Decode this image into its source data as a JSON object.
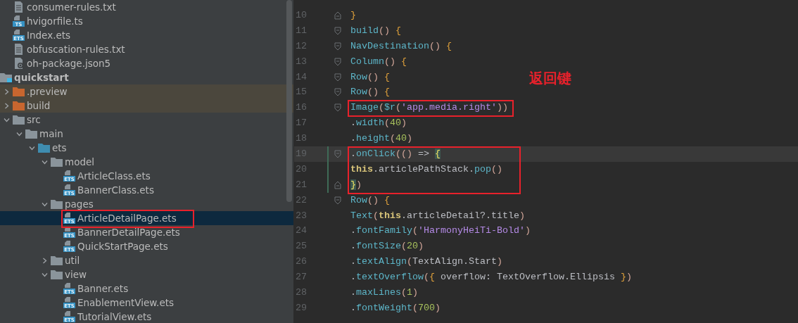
{
  "project_tree": {
    "cut_off_files": [
      {
        "name": "consumer-rules.txt",
        "kind": "text",
        "selected": false,
        "excluded": false,
        "boxed": false
      },
      {
        "name": "hvigorfile.ts",
        "kind": "code",
        "badge": "TS",
        "selected": false,
        "excluded": false,
        "boxed": false
      },
      {
        "name": "Index.ets",
        "kind": "code",
        "badge": "ETS",
        "selected": false,
        "excluded": false,
        "boxed": false
      },
      {
        "name": "obfuscation-rules.txt",
        "kind": "text",
        "selected": false,
        "excluded": false,
        "boxed": false
      },
      {
        "name": "oh-package.json5",
        "kind": "json",
        "selected": false,
        "excluded": false,
        "boxed": false
      }
    ],
    "modules": [
      {
        "name": "quickstart",
        "kind": "module",
        "selected": false,
        "excluded": false,
        "boxed": false,
        "children": [
          {
            "name": ".preview",
            "kind": "excluded_folder",
            "expanded": false,
            "selected": false,
            "excluded": true,
            "boxed": false
          },
          {
            "name": "build",
            "kind": "excluded_folder",
            "expanded": false,
            "selected": false,
            "excluded": true,
            "boxed": false
          },
          {
            "name": "src",
            "kind": "folder",
            "expanded": true,
            "selected": false,
            "excluded": false,
            "boxed": false,
            "children": [
              {
                "name": "main",
                "kind": "folder",
                "expanded": true,
                "selected": false,
                "excluded": false,
                "boxed": false,
                "children": [
                  {
                    "name": "ets",
                    "kind": "source_folder",
                    "expanded": true,
                    "selected": false,
                    "excluded": false,
                    "boxed": false,
                    "children": [
                      {
                        "name": "model",
                        "kind": "folder",
                        "expanded": true,
                        "selected": false,
                        "excluded": false,
                        "boxed": false,
                        "children": [
                          {
                            "name": "ArticleClass.ets",
                            "kind": "code",
                            "badge": "ETS",
                            "selected": false,
                            "excluded": false,
                            "boxed": false
                          },
                          {
                            "name": "BannerClass.ets",
                            "kind": "code",
                            "badge": "ETS",
                            "selected": false,
                            "excluded": false,
                            "boxed": false
                          }
                        ]
                      },
                      {
                        "name": "pages",
                        "kind": "folder",
                        "expanded": true,
                        "selected": false,
                        "excluded": false,
                        "boxed": false,
                        "children": [
                          {
                            "name": "ArticleDetailPage.ets",
                            "kind": "code",
                            "badge": "ETS",
                            "selected": true,
                            "excluded": false,
                            "boxed": true
                          },
                          {
                            "name": "BannerDetailPage.ets",
                            "kind": "code",
                            "badge": "ETS",
                            "selected": false,
                            "excluded": false,
                            "boxed": false
                          },
                          {
                            "name": "QuickStartPage.ets",
                            "kind": "code",
                            "badge": "ETS",
                            "selected": false,
                            "excluded": false,
                            "boxed": false
                          }
                        ]
                      },
                      {
                        "name": "util",
                        "kind": "folder",
                        "expanded": false,
                        "selected": false,
                        "excluded": false,
                        "boxed": false
                      },
                      {
                        "name": "view",
                        "kind": "folder",
                        "expanded": true,
                        "selected": false,
                        "excluded": false,
                        "boxed": false,
                        "children": [
                          {
                            "name": "Banner.ets",
                            "kind": "code",
                            "badge": "ETS",
                            "selected": false,
                            "excluded": false,
                            "boxed": false
                          },
                          {
                            "name": "EnablementView.ets",
                            "kind": "code",
                            "badge": "ETS",
                            "selected": false,
                            "excluded": false,
                            "boxed": false
                          },
                          {
                            "name": "TutorialView.ets",
                            "kind": "code",
                            "badge": "ETS",
                            "selected": false,
                            "excluded": false,
                            "boxed": false
                          }
                        ]
                      }
                    ]
                  }
                ]
              }
            ]
          }
        ]
      }
    ]
  },
  "editor": {
    "label": "返回键",
    "lines": [
      {
        "number": "10",
        "fold_start": false,
        "fold_end": true,
        "changed": false,
        "current": false,
        "boxed": false,
        "tokens": [
          {
            "kind": "brace",
            "text": "}"
          }
        ]
      },
      {
        "number": "11",
        "fold_start": true,
        "fold_end": false,
        "changed": false,
        "current": false,
        "boxed": false,
        "tokens": [
          {
            "kind": "function",
            "text": "build"
          },
          {
            "kind": "paren",
            "text": "()"
          },
          {
            "kind": "brace",
            "text": " {"
          }
        ]
      },
      {
        "number": "12",
        "fold_start": true,
        "fold_end": false,
        "changed": false,
        "current": false,
        "boxed": false,
        "tokens": [
          {
            "kind": "function",
            "text": "  NavDestination"
          },
          {
            "kind": "paren",
            "text": "()"
          },
          {
            "kind": "brace",
            "text": " {"
          }
        ]
      },
      {
        "number": "13",
        "fold_start": true,
        "fold_end": false,
        "changed": false,
        "current": false,
        "boxed": false,
        "tokens": [
          {
            "kind": "function",
            "text": "    Column"
          },
          {
            "kind": "paren",
            "text": "()"
          },
          {
            "kind": "brace",
            "text": " {"
          }
        ]
      },
      {
        "number": "14",
        "fold_start": true,
        "fold_end": false,
        "changed": false,
        "current": false,
        "boxed": false,
        "tokens": [
          {
            "kind": "function",
            "text": "      Row"
          },
          {
            "kind": "paren",
            "text": "()"
          },
          {
            "kind": "brace",
            "text": " {"
          }
        ]
      },
      {
        "number": "15",
        "fold_start": true,
        "fold_end": false,
        "changed": false,
        "current": false,
        "boxed": false,
        "tokens": [
          {
            "kind": "function",
            "text": "        Row"
          },
          {
            "kind": "paren",
            "text": "()"
          },
          {
            "kind": "brace",
            "text": " {"
          }
        ]
      },
      {
        "number": "16",
        "fold_start": true,
        "fold_end": false,
        "changed": false,
        "current": false,
        "boxed": true,
        "tokens": [
          {
            "kind": "function",
            "text": "          Image"
          },
          {
            "kind": "paren",
            "text": "("
          },
          {
            "kind": "function",
            "text": "$r"
          },
          {
            "kind": "paren",
            "text": "("
          },
          {
            "kind": "string",
            "text": "'app.media.right'"
          },
          {
            "kind": "paren",
            "text": "))"
          }
        ]
      },
      {
        "number": "17",
        "fold_start": false,
        "fold_end": false,
        "changed": false,
        "current": false,
        "boxed": false,
        "tokens": [
          {
            "kind": "plain",
            "text": "            ."
          },
          {
            "kind": "function",
            "text": "width"
          },
          {
            "kind": "paren",
            "text": "("
          },
          {
            "kind": "number",
            "text": "40"
          },
          {
            "kind": "paren",
            "text": ")"
          }
        ]
      },
      {
        "number": "18",
        "fold_start": false,
        "fold_end": false,
        "changed": false,
        "current": false,
        "boxed": false,
        "tokens": [
          {
            "kind": "plain",
            "text": "            ."
          },
          {
            "kind": "function",
            "text": "height"
          },
          {
            "kind": "paren",
            "text": "("
          },
          {
            "kind": "number",
            "text": "40"
          },
          {
            "kind": "paren",
            "text": ")"
          }
        ]
      },
      {
        "number": "19",
        "fold_start": true,
        "fold_end": false,
        "changed": true,
        "current": true,
        "boxed": true,
        "tokens": [
          {
            "kind": "plain",
            "text": "            ."
          },
          {
            "kind": "function",
            "text": "onClick"
          },
          {
            "kind": "paren",
            "text": "(()"
          },
          {
            "kind": "plain",
            "text": " => "
          },
          {
            "kind": "brace_match",
            "text": "{"
          }
        ]
      },
      {
        "number": "20",
        "fold_start": false,
        "fold_end": false,
        "changed": true,
        "current": false,
        "boxed": true,
        "tokens": [
          {
            "kind": "keyword",
            "text": "              this"
          },
          {
            "kind": "plain",
            "text": ".articlePathStack."
          },
          {
            "kind": "function",
            "text": "pop"
          },
          {
            "kind": "paren",
            "text": "()"
          }
        ]
      },
      {
        "number": "21",
        "fold_start": false,
        "fold_end": true,
        "changed": true,
        "current": false,
        "boxed": true,
        "tokens": [
          {
            "kind": "brace_match",
            "text": "            }"
          },
          {
            "kind": "paren",
            "text": ")"
          }
        ]
      },
      {
        "number": "22",
        "fold_start": true,
        "fold_end": false,
        "changed": false,
        "current": false,
        "boxed": false,
        "tokens": [
          {
            "kind": "function",
            "text": "          Row"
          },
          {
            "kind": "paren",
            "text": "()"
          },
          {
            "kind": "brace",
            "text": " {"
          }
        ]
      },
      {
        "number": "23",
        "fold_start": false,
        "fold_end": false,
        "changed": false,
        "current": false,
        "boxed": false,
        "tokens": [
          {
            "kind": "function",
            "text": "            Text"
          },
          {
            "kind": "paren",
            "text": "("
          },
          {
            "kind": "keyword",
            "text": "this"
          },
          {
            "kind": "plain",
            "text": ".articleDetail?.title"
          },
          {
            "kind": "paren",
            "text": ")"
          }
        ]
      },
      {
        "number": "24",
        "fold_start": false,
        "fold_end": false,
        "changed": false,
        "current": false,
        "boxed": false,
        "tokens": [
          {
            "kind": "plain",
            "text": "              ."
          },
          {
            "kind": "function",
            "text": "fontFamily"
          },
          {
            "kind": "paren",
            "text": "("
          },
          {
            "kind": "string",
            "text": "'HarmonyHeiTi-Bold'"
          },
          {
            "kind": "paren",
            "text": ")"
          }
        ]
      },
      {
        "number": "25",
        "fold_start": false,
        "fold_end": false,
        "changed": false,
        "current": false,
        "boxed": false,
        "tokens": [
          {
            "kind": "plain",
            "text": "              ."
          },
          {
            "kind": "function",
            "text": "fontSize"
          },
          {
            "kind": "paren",
            "text": "("
          },
          {
            "kind": "number",
            "text": "20"
          },
          {
            "kind": "paren",
            "text": ")"
          }
        ]
      },
      {
        "number": "26",
        "fold_start": false,
        "fold_end": false,
        "changed": false,
        "current": false,
        "boxed": false,
        "tokens": [
          {
            "kind": "plain",
            "text": "              ."
          },
          {
            "kind": "function",
            "text": "textAlign"
          },
          {
            "kind": "paren",
            "text": "("
          },
          {
            "kind": "plain",
            "text": "TextAlign.Start"
          },
          {
            "kind": "paren",
            "text": ")"
          }
        ]
      },
      {
        "number": "27",
        "fold_start": false,
        "fold_end": false,
        "changed": false,
        "current": false,
        "boxed": false,
        "tokens": [
          {
            "kind": "plain",
            "text": "              ."
          },
          {
            "kind": "function",
            "text": "textOverflow"
          },
          {
            "kind": "paren",
            "text": "("
          },
          {
            "kind": "brace",
            "text": "{"
          },
          {
            "kind": "plain",
            "text": " overflow: TextOverflow.Ellipsis "
          },
          {
            "kind": "brace",
            "text": "}"
          },
          {
            "kind": "paren",
            "text": ")"
          }
        ]
      },
      {
        "number": "28",
        "fold_start": false,
        "fold_end": false,
        "changed": false,
        "current": false,
        "boxed": false,
        "tokens": [
          {
            "kind": "plain",
            "text": "              ."
          },
          {
            "kind": "function",
            "text": "maxLines"
          },
          {
            "kind": "paren",
            "text": "("
          },
          {
            "kind": "number",
            "text": "1"
          },
          {
            "kind": "paren",
            "text": ")"
          }
        ]
      },
      {
        "number": "29",
        "fold_start": false,
        "fold_end": false,
        "changed": false,
        "current": false,
        "boxed": false,
        "tokens": [
          {
            "kind": "plain",
            "text": "              ."
          },
          {
            "kind": "function",
            "text": "fontWeight"
          },
          {
            "kind": "paren",
            "text": "("
          },
          {
            "kind": "number",
            "text": "700"
          },
          {
            "kind": "paren",
            "text": ")"
          }
        ]
      }
    ]
  }
}
